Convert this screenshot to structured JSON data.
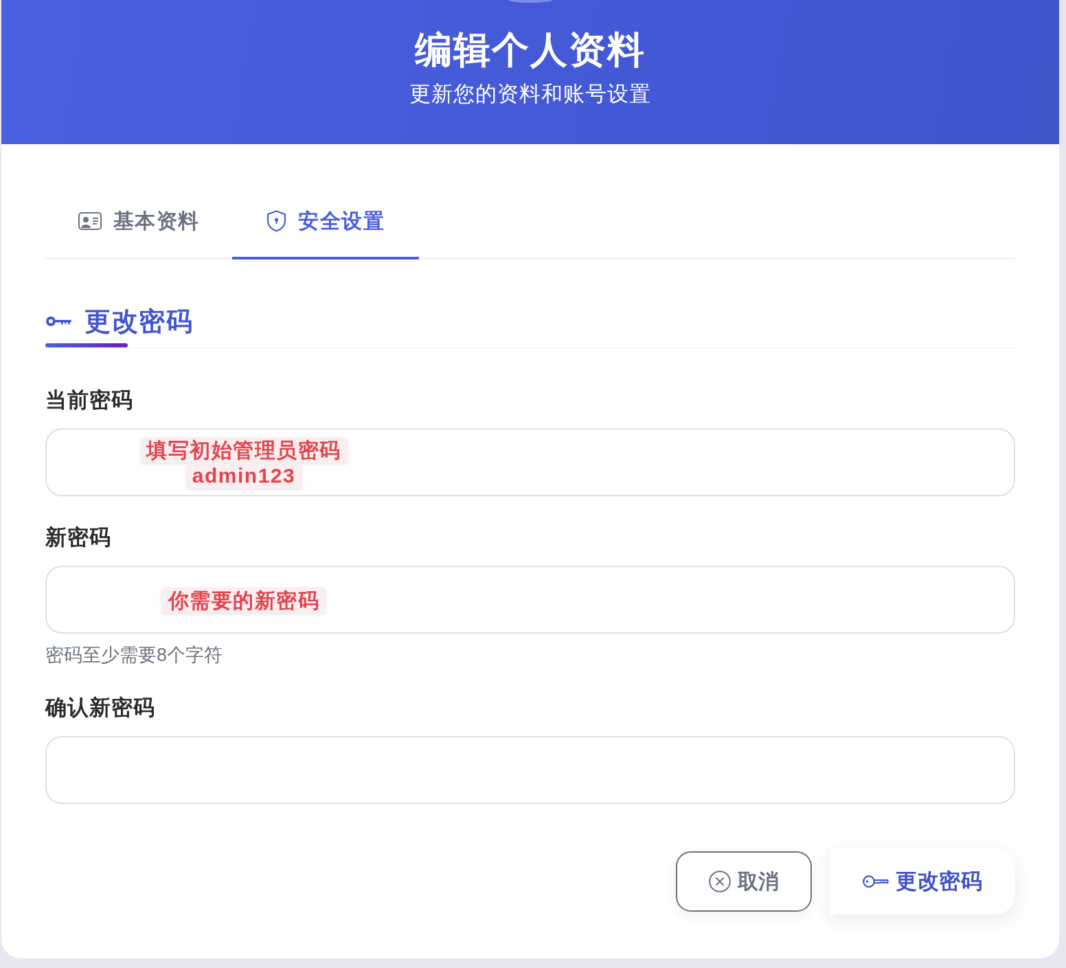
{
  "header": {
    "title": "编辑个人资料",
    "subtitle": "更新您的资料和账号设置"
  },
  "tabs": [
    {
      "label": "基本资料",
      "kind": "profile",
      "selected": false
    },
    {
      "label": "安全设置",
      "kind": "security",
      "selected": true
    }
  ],
  "section": {
    "title": "更改密码"
  },
  "fields": [
    {
      "label": "当前密码",
      "annotations": [
        "填写初始管理员密码",
        "admin123"
      ]
    },
    {
      "label": "新密码",
      "annotations": [
        "你需要的新密码"
      ],
      "help": "密码至少需要8个字符"
    },
    {
      "label": "确认新密码"
    }
  ],
  "buttons": [
    {
      "label": "取消",
      "kind": "cancel"
    },
    {
      "label": "更改密码",
      "kind": "submit"
    }
  ]
}
